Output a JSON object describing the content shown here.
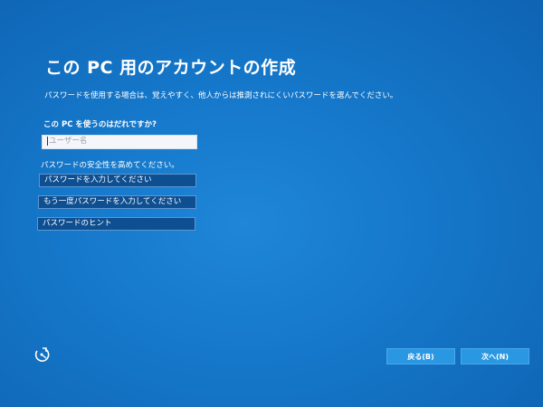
{
  "page": {
    "title": "この PC 用のアカウントの作成",
    "description": "パスワードを使用する場合は、覚えやすく、他人からは推測されにくいパスワードを選んでください。"
  },
  "username": {
    "label": "この PC を使うのはだれですか?",
    "placeholder": "ユーザー名"
  },
  "password": {
    "label": "パスワードの安全性を高めてください。",
    "field1_placeholder": "パスワードを入力してください",
    "field2_placeholder": "もう一度パスワードを入力してください",
    "hint_placeholder": "パスワードのヒント"
  },
  "footer": {
    "accessibility_icon": "ease-of-access-icon",
    "back_label": "戻る(B)",
    "next_label": "次へ(N)"
  },
  "colors": {
    "background": "#1577c9",
    "button": "#2a97e2",
    "input_dark": "#0e4f92"
  }
}
